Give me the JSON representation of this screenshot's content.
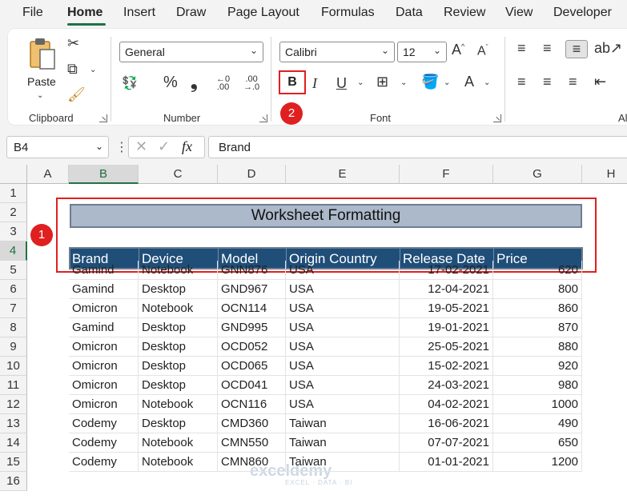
{
  "menu": [
    "File",
    "Home",
    "Insert",
    "Draw",
    "Page Layout",
    "Formulas",
    "Data",
    "Review",
    "View",
    "Developer"
  ],
  "ribbon": {
    "clipboard": {
      "paste_label": "Paste",
      "group_label": "Clipboard"
    },
    "number": {
      "format": "General",
      "group_label": "Number"
    },
    "font": {
      "family": "Calibri",
      "size": "12",
      "bold_label": "B",
      "italic_label": "I",
      "underline_label": "U",
      "group_label": "Font"
    },
    "alignment": {
      "group_label_partial": "Al"
    }
  },
  "badges": {
    "one": "1",
    "two": "2"
  },
  "formula_bar": {
    "name_box": "B4",
    "formula": "Brand",
    "fx": "fx"
  },
  "columns": [
    "A",
    "B",
    "C",
    "D",
    "E",
    "F",
    "G",
    "H"
  ],
  "rows": [
    "1",
    "2",
    "3",
    "4",
    "5",
    "6",
    "7",
    "8",
    "9",
    "10",
    "11",
    "12",
    "13",
    "14",
    "15",
    "16"
  ],
  "sheet": {
    "title": "Worksheet Formatting",
    "headers": [
      "Brand",
      "Device",
      "Model",
      "Origin Country",
      "Release Date",
      "Price"
    ],
    "data": [
      [
        "Gamind",
        "Notebook",
        "GNN876",
        "USA",
        "17-02-2021",
        "620"
      ],
      [
        "Gamind",
        "Desktop",
        "GND967",
        "USA",
        "12-04-2021",
        "800"
      ],
      [
        "Omicron",
        "Notebook",
        "OCN114",
        "USA",
        "19-05-2021",
        "860"
      ],
      [
        "Gamind",
        "Desktop",
        "GND995",
        "USA",
        "19-01-2021",
        "870"
      ],
      [
        "Omicron",
        "Desktop",
        "OCD052",
        "USA",
        "25-05-2021",
        "880"
      ],
      [
        "Omicron",
        "Desktop",
        "OCD065",
        "USA",
        "15-02-2021",
        "920"
      ],
      [
        "Omicron",
        "Desktop",
        "OCD041",
        "USA",
        "24-03-2021",
        "980"
      ],
      [
        "Omicron",
        "Notebook",
        "OCN116",
        "USA",
        "04-02-2021",
        "1000"
      ],
      [
        "Codemy",
        "Desktop",
        "CMD360",
        "Taiwan",
        "16-06-2021",
        "490"
      ],
      [
        "Codemy",
        "Notebook",
        "CMN550",
        "Taiwan",
        "07-07-2021",
        "650"
      ],
      [
        "Codemy",
        "Notebook",
        "CMN860",
        "Taiwan",
        "01-01-2021",
        "1200"
      ]
    ]
  },
  "watermark": {
    "name": "exceldemy",
    "tagline": "EXCEL · DATA · BI"
  },
  "colors": {
    "header_fill": "#1f4e79",
    "title_fill": "#acb9ca",
    "highlight": "#e02020",
    "accent": "#217346"
  }
}
